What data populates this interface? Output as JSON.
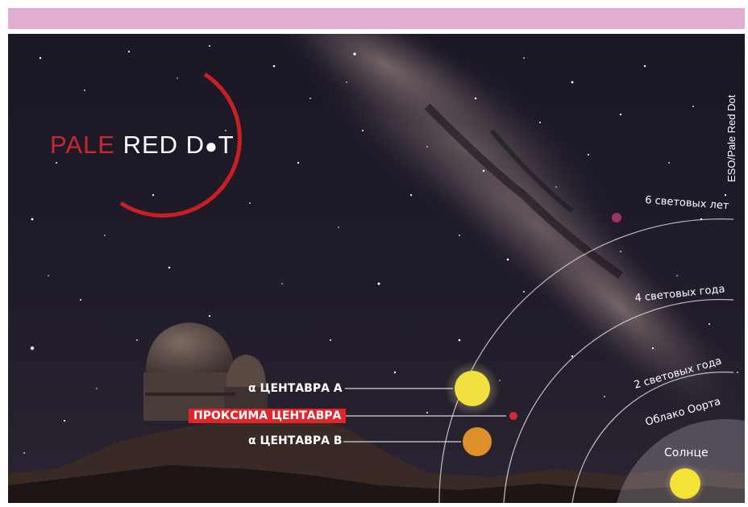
{
  "colors": {
    "header_bar": "#e0aed1",
    "sky": "#15131d",
    "logo_ring": "#c81e24",
    "logo_red_text": "#c9282d",
    "alpha_a": "#f2e040",
    "alpha_b": "#e0902a",
    "proxima": "#d22a36",
    "sun": "#f4e235",
    "proxima_label_bg": "#e3242b"
  },
  "logo": {
    "word_red": "PALE ",
    "word_white": "RED D",
    "dot_glyph": "●",
    "word_end": "T"
  },
  "credit": "ESO/Pale Red Dot",
  "rings": [
    "6 световых лет",
    "4 световых года",
    "2 световых года",
    "Облако Оорта"
  ],
  "stars": {
    "alpha_a": "α ЦЕНТАВРА A",
    "proxima": "ПРОКСИМА ЦЕНТАВРА",
    "alpha_b": "α ЦЕНТАВРА B",
    "sun": "Солнце"
  }
}
